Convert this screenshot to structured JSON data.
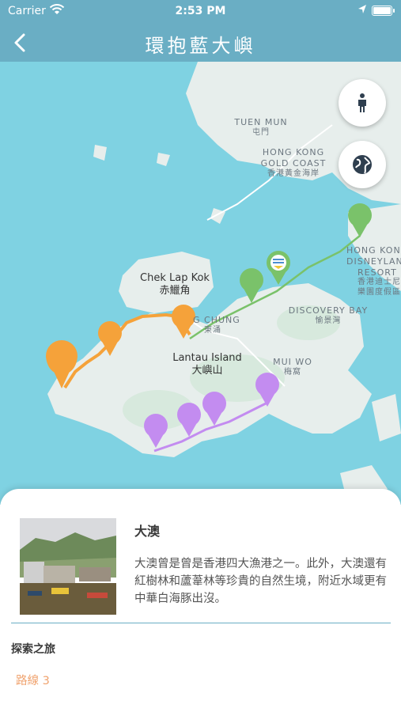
{
  "status_bar": {
    "carrier": "Carrier",
    "time": "2:53 PM"
  },
  "nav": {
    "title": "環抱藍大嶼",
    "back_icon": "chevron-left-icon"
  },
  "map": {
    "labels": {
      "tuen_mun_en": "TUEN MUN",
      "tuen_mun_zh": "屯門",
      "gold_coast_en_1": "HONG KONG",
      "gold_coast_en_2": "GOLD COAST",
      "gold_coast_zh": "香港黃金海岸",
      "chek_lap_kok_en": "Chek Lap Kok",
      "chek_lap_kok_zh": "赤鱲角",
      "tung_chung_en": "G CHUNG",
      "tung_chung_zh": "東涌",
      "lantau_en": "Lantau Island",
      "lantau_zh": "大嶼山",
      "discovery_bay_en": "DISCOVERY BAY",
      "discovery_bay_zh": "愉景灣",
      "mui_wo_en": "MUI WO",
      "mui_wo_zh": "梅窩",
      "disney_en_1": "HONG KON",
      "disney_en_2": "DISNEYLAN",
      "disney_en_3": "RESORT",
      "disney_zh_1": "香港迪士尼",
      "disney_zh_2": "樂園度假區"
    },
    "colors": {
      "water": "#7fd2e2",
      "land": "#e7eeec",
      "route_orange": "#f5a23a",
      "route_green": "#7ac26a",
      "route_purple": "#c38cf0"
    },
    "fab_icons": [
      "person-icon",
      "globe-icon"
    ]
  },
  "place": {
    "name": "大澳",
    "description": "大澳曾是曾是香港四大漁港之一。此外，大澳還有紅樹林和蘆葦林等珍貴的自然生境，附近水域更有中華白海豚出沒。"
  },
  "explore": {
    "section_title": "探索之旅",
    "route_label": "路線 3"
  }
}
